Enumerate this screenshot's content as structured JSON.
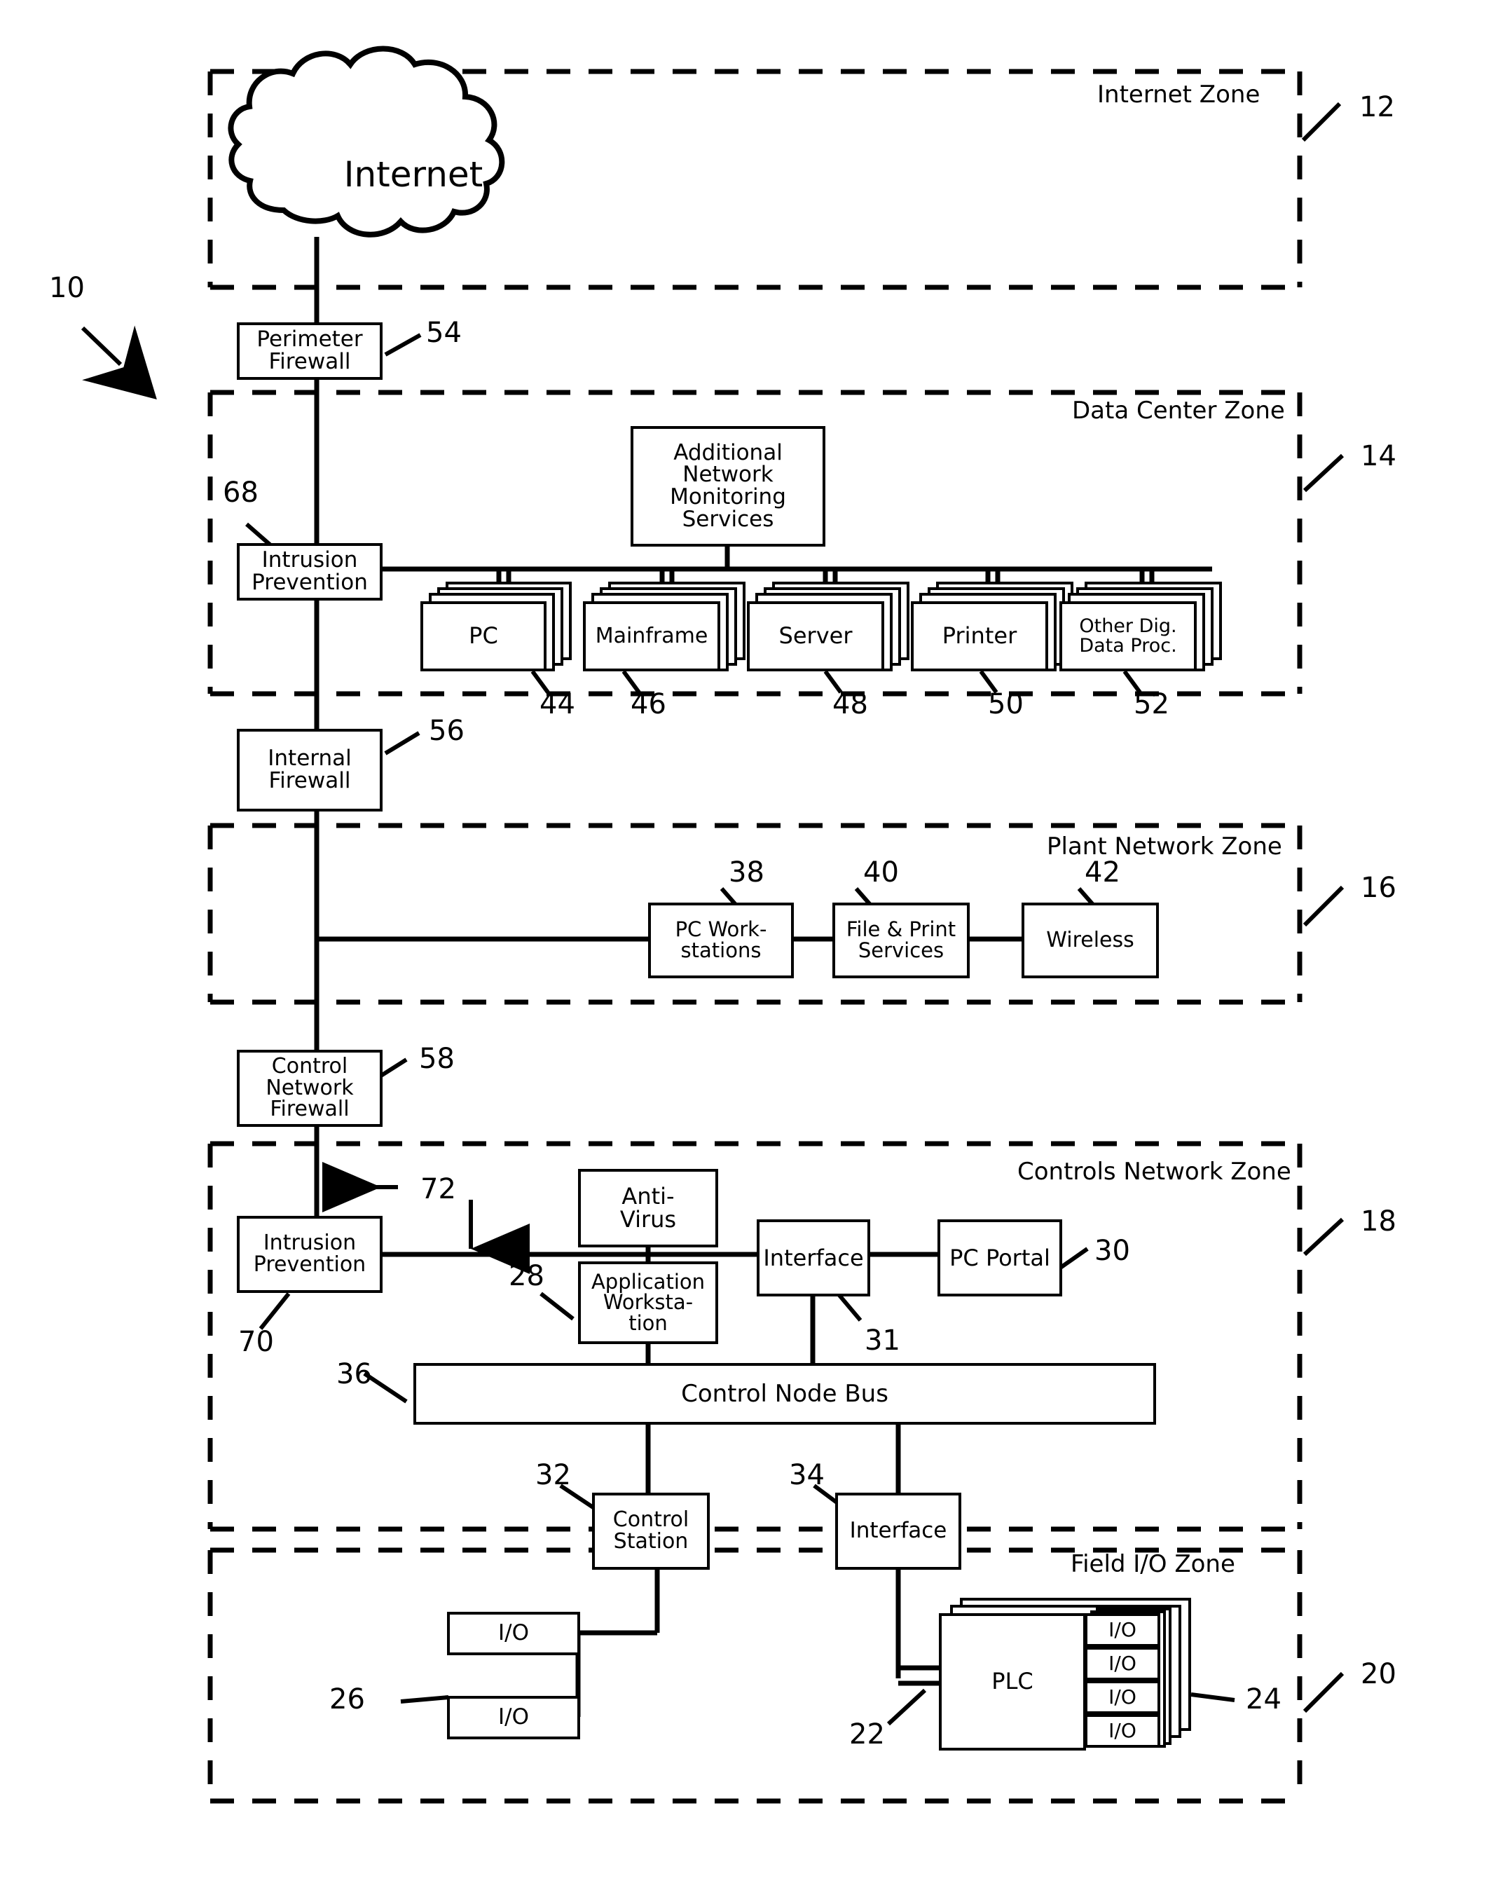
{
  "figure": {
    "id_label": "10",
    "cloud_label": "Internet"
  },
  "zones": [
    {
      "key": "internet",
      "name": "Internet Zone",
      "ref": "12"
    },
    {
      "key": "datacenter",
      "name": "Data Center Zone",
      "ref": "14"
    },
    {
      "key": "plant",
      "name": "Plant Network Zone",
      "ref": "16"
    },
    {
      "key": "controls",
      "name": "Controls Network Zone",
      "ref": "18"
    },
    {
      "key": "fieldio",
      "name": "Field I/O Zone",
      "ref": "20"
    }
  ],
  "blocks": {
    "perimeter_firewall": {
      "label": "Perimeter\nFirewall",
      "ref": "54"
    },
    "intrusion_prevention_1": {
      "label": "Intrusion\nPrevention",
      "ref": "68"
    },
    "monitoring": {
      "label": "Additional\nNetwork\nMonitoring\nServices",
      "ref": ""
    },
    "pc": {
      "label": "PC",
      "ref": "44"
    },
    "mainframe": {
      "label": "Mainframe",
      "ref": "46"
    },
    "server": {
      "label": "Server",
      "ref": "48"
    },
    "printer": {
      "label": "Printer",
      "ref": "50"
    },
    "other_dig": {
      "label": "Other Dig.\nData Proc.",
      "ref": "52"
    },
    "internal_firewall": {
      "label": "Internal\nFirewall",
      "ref": "56"
    },
    "pc_workstations": {
      "label": "PC Work-\nstations",
      "ref": "38"
    },
    "file_print": {
      "label": "File & Print\nServices",
      "ref": "40"
    },
    "wireless": {
      "label": "Wireless",
      "ref": "42"
    },
    "control_network_firewall": {
      "label": "Control\nNetwork\nFirewall",
      "ref": "58"
    },
    "intrusion_prevention_2": {
      "label": "Intrusion\nPrevention",
      "ref": "70"
    },
    "traffic_arrow": {
      "label": "",
      "ref": "72"
    },
    "anti_virus": {
      "label": "Anti-\nVirus",
      "ref": ""
    },
    "application_workstation": {
      "label": "Application\nWorksta-\ntion",
      "ref": "28"
    },
    "interface_top": {
      "label": "Interface",
      "ref": "31"
    },
    "pc_portal": {
      "label": "PC Portal",
      "ref": "30"
    },
    "control_node_bus": {
      "label": "Control Node Bus",
      "ref": "36"
    },
    "control_station": {
      "label": "Control\nStation",
      "ref": "32"
    },
    "interface_bottom": {
      "label": "Interface",
      "ref": "34"
    },
    "io_a": {
      "label": "I/O",
      "ref": ""
    },
    "io_b": {
      "label": "I/O",
      "ref": ""
    },
    "io_group_ref": {
      "label": "",
      "ref": "26"
    },
    "plc": {
      "label": "PLC",
      "ref": "22"
    },
    "plc_io_1": {
      "label": "I/O",
      "ref": ""
    },
    "plc_io_2": {
      "label": "I/O",
      "ref": ""
    },
    "plc_io_3": {
      "label": "I/O",
      "ref": ""
    },
    "plc_io_4": {
      "label": "I/O",
      "ref": ""
    },
    "plc_io_group_ref": {
      "label": "",
      "ref": "24"
    }
  },
  "colors": {
    "stroke": "#000000",
    "background": "#ffffff"
  }
}
